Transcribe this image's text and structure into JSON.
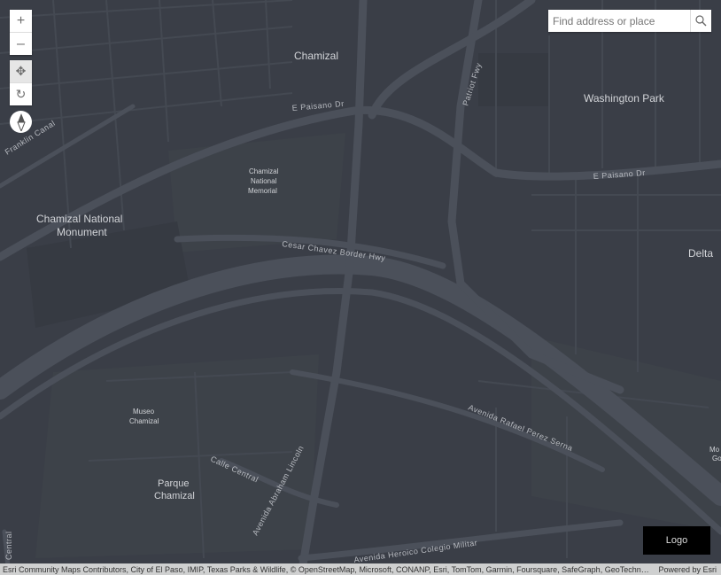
{
  "search": {
    "placeholder": "Find address or place",
    "icon": "search-icon"
  },
  "controls": {
    "zoom_in": "+",
    "zoom_out": "–",
    "pan_icon": "pan-icon",
    "rotate_icon": "rotate-icon",
    "compass_icon": "compass-icon"
  },
  "map": {
    "labels": {
      "chamizal": "Chamizal",
      "washington_park": "Washington Park",
      "memorial_1": "Chamizal",
      "memorial_2": "National",
      "memorial_3": "Memorial",
      "monument_1": "Chamizal National",
      "monument_2": "Monument",
      "delta": "Delta",
      "museo_1": "Museo",
      "museo_2": "Chamizal",
      "parque_1": "Parque",
      "parque_2": "Chamizal",
      "mo_1": "Mo",
      "mo_2": "Go"
    },
    "roads": {
      "paisano_west": "E Paisano Dr",
      "paisano_east": "E Paisano Dr",
      "patriot": "Patriot Fwy",
      "border_hwy": "Cesar Chavez Border Hwy",
      "rafael": "Avenida Rafael Perez Serna",
      "calle_central": "Calle Central",
      "lincoln": "Avenida Abraham Lincoln",
      "colegio": "Avenida Heroico Colegio Militar",
      "central": "Central",
      "franklin": "Franklin Canal"
    }
  },
  "logo": "Logo",
  "attribution": {
    "text": "Esri Community Maps Contributors, City of El Paso, IMIP, Texas Parks & Wildlife, © OpenStreetMap, Microsoft, CONANP, Esri, TomTom, Garmin, Foursquare, SafeGraph, GeoTechnologies, Inc, METI/NASA, USGS, EPA, NPS, US Census Bureau, USDA, USFWS",
    "powered_by": "Powered by Esri"
  }
}
